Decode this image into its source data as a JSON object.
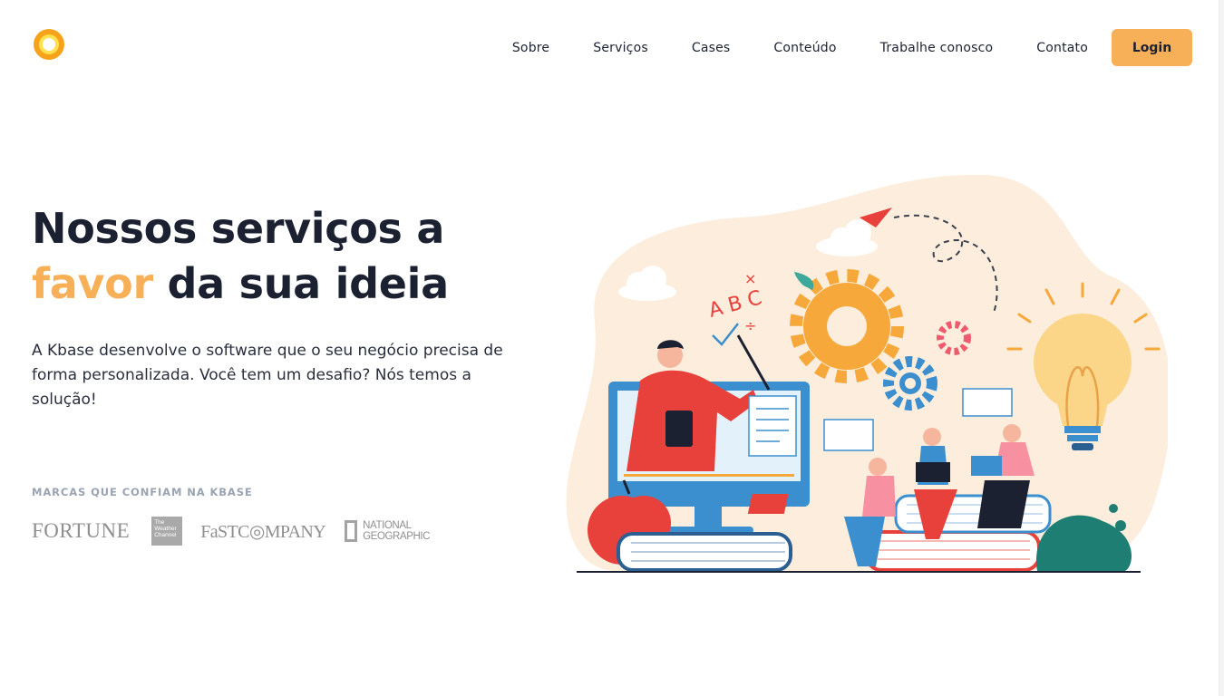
{
  "header": {
    "logo_icon": "sun-logo-icon",
    "nav": {
      "sobre": "Sobre",
      "servicos": "Serviços",
      "cases": "Cases",
      "conteudo": "Conteúdo",
      "trabalhe": "Trabalhe conosco",
      "contato": "Contato"
    },
    "login_label": "Login"
  },
  "hero": {
    "title_line1": "Nossos serviços a",
    "title_accent": "favor",
    "title_line2_rest": " da sua ideia",
    "description": "A Kbase desenvolve o software que o seu negócio precisa de forma personalizada. Você tem um desafio? Nós temos a solução!",
    "brands_label": "MARCAS QUE CONFIAM NA KBASE",
    "brands": {
      "fortune": "FORTUNE",
      "weather": "The Weather Channel",
      "fastcompany": "FaSTC◎MPANY",
      "natgeo": "NATIONAL GEOGRAPHIC"
    }
  },
  "illustration": {
    "icon": "online-education-illustration",
    "board_text": "A B C"
  },
  "colors": {
    "accent": "#f7b058",
    "text_dark": "#1c2132",
    "muted": "#9aa3b2"
  }
}
